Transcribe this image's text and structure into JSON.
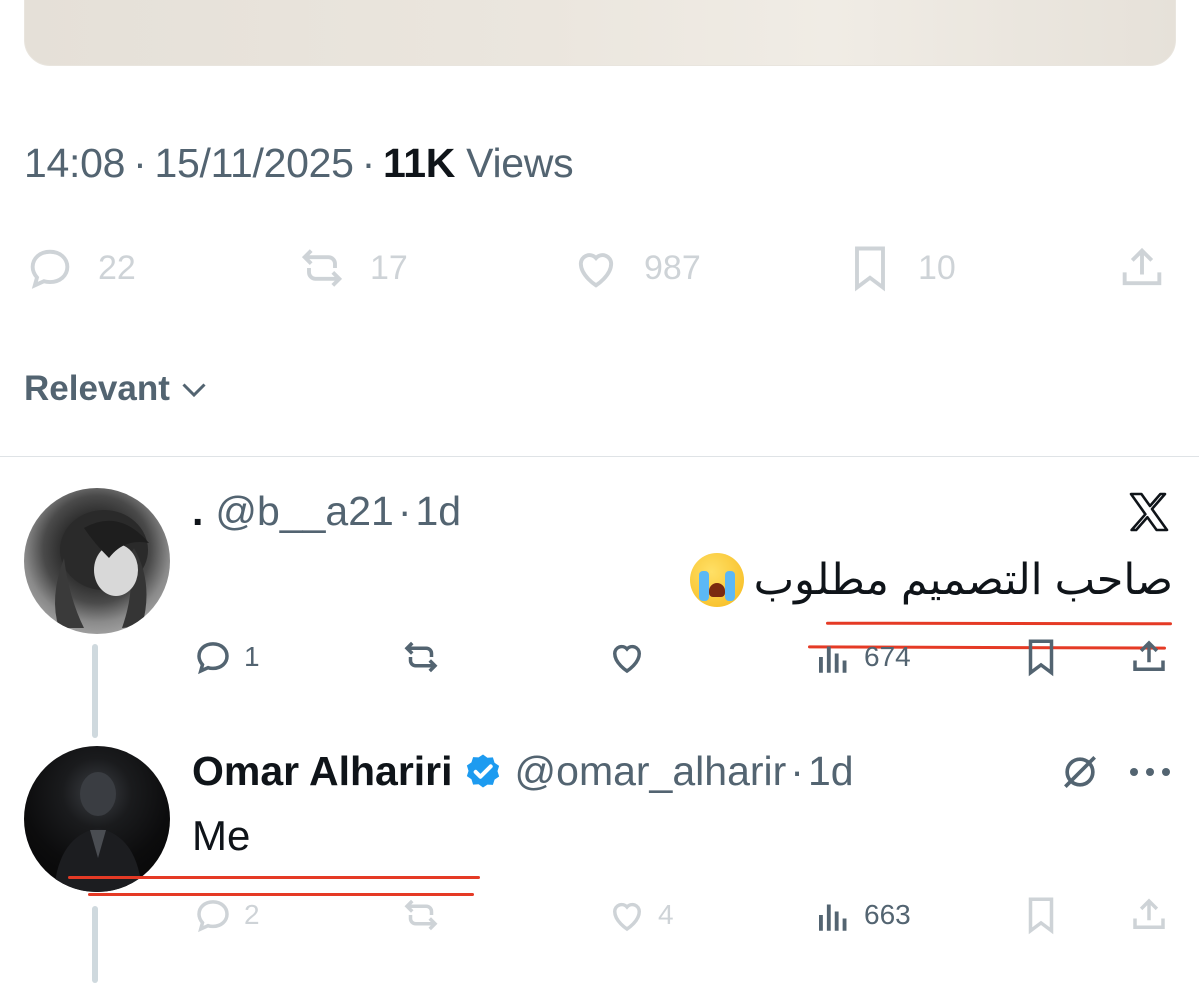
{
  "tweet": {
    "time": "14:08",
    "date": "15/11/2025",
    "views_count": "11K",
    "views_label": "Views",
    "actions": {
      "replies": "22",
      "reposts": "17",
      "likes": "987",
      "bookmarks": "10"
    }
  },
  "sort": {
    "label": "Relevant"
  },
  "reply1": {
    "name": ".",
    "handle": "@b__a21",
    "age": "1d",
    "text": "صاحب التصميم مطلوب",
    "emoji": "loudly-crying-face",
    "actions": {
      "replies": "1",
      "views": "674"
    }
  },
  "reply2": {
    "name": "Omar Alhariri",
    "handle": "@omar_alharir",
    "age": "1d",
    "text": "Me",
    "actions": {
      "replies": "2",
      "likes": "4",
      "views": "663"
    }
  },
  "colors": {
    "text": "#0f1419",
    "muted": "#536471",
    "verified": "#1d9bf0",
    "highlight": "#e53a25"
  },
  "icons": [
    "reply-icon",
    "repost-icon",
    "like-icon",
    "bookmark-icon",
    "share-icon",
    "views-icon",
    "chevron-down-icon",
    "x-logo-icon",
    "verified-icon",
    "grok-icon",
    "more-icon"
  ]
}
